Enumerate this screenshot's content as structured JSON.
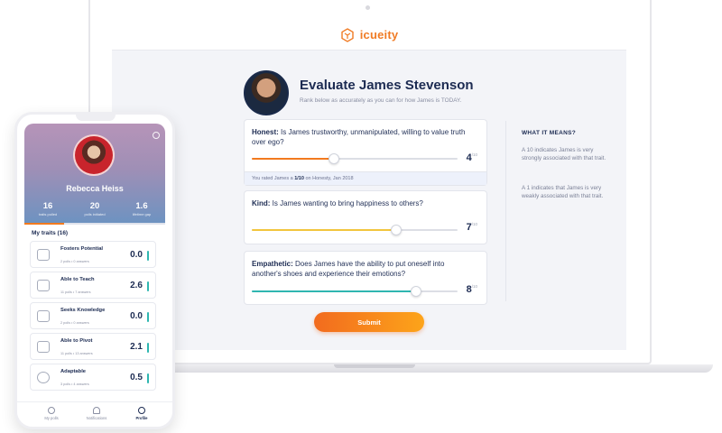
{
  "app": {
    "brand": "icueity",
    "brand_color": "#f07b24"
  },
  "evaluation": {
    "title": "Evaluate James Stevenson",
    "subtitle": "Rank below as accurately as you can for how James is TODAY.",
    "questions": [
      {
        "trait": "Honest:",
        "question": "Is James trustworthy, unmanipulated, willing to value truth over ego?",
        "score": "4",
        "score_suffix": "/10",
        "value": 4,
        "max": 10,
        "color": "#f27a1e",
        "footer": {
          "prefix": "You rated James a",
          "rating": "1/10",
          "suffix": "on Honesty, Jan 2018"
        }
      },
      {
        "trait": "Kind:",
        "question": "Is James wanting to bring happiness to others?",
        "score": "7",
        "score_suffix": "/10",
        "value": 7,
        "max": 10,
        "color": "#f2c53d"
      },
      {
        "trait": "Empathetic:",
        "question": "Does James have the ability to put oneself into another's shoes and experience their emotions?",
        "score": "8",
        "score_suffix": "/10",
        "value": 8,
        "max": 10,
        "color": "#2fb6b0"
      }
    ],
    "submit_label": "Submit"
  },
  "sidebar": {
    "title": "WHAT IT MEANS?",
    "text_high": "A 10 indicates James is very strongly associated with that trait.",
    "text_low": "A 1 indicates that James is very weakly associated with that trait."
  },
  "phone": {
    "profile_name": "Rebecca Heiss",
    "stats": [
      {
        "value": "16",
        "label": "traits polled"
      },
      {
        "value": "20",
        "label": "polls initiated"
      },
      {
        "value": "1.6",
        "label": "lifetime gap"
      }
    ],
    "traits_title": "My traits (16)",
    "traits": [
      {
        "name": "Fosters Potential",
        "meta": "2 polls • 0 answers",
        "score": "0.0"
      },
      {
        "name": "Able to Teach",
        "meta": "11 polls • 7 answers",
        "score": "2.6"
      },
      {
        "name": "Seeks Knowledge",
        "meta": "2 polls • 0 answers",
        "score": "0.0"
      },
      {
        "name": "Able to Pivot",
        "meta": "11 polls • 13 answers",
        "score": "2.1"
      },
      {
        "name": "Adaptable",
        "meta": "3 polls • 4 answers",
        "score": "0.5"
      }
    ],
    "tabs": [
      {
        "label": "My polls",
        "icon": "polls-icon"
      },
      {
        "label": "Notifications",
        "icon": "bell-icon"
      },
      {
        "label": "Profile",
        "icon": "profile-icon",
        "active": true
      }
    ]
  }
}
